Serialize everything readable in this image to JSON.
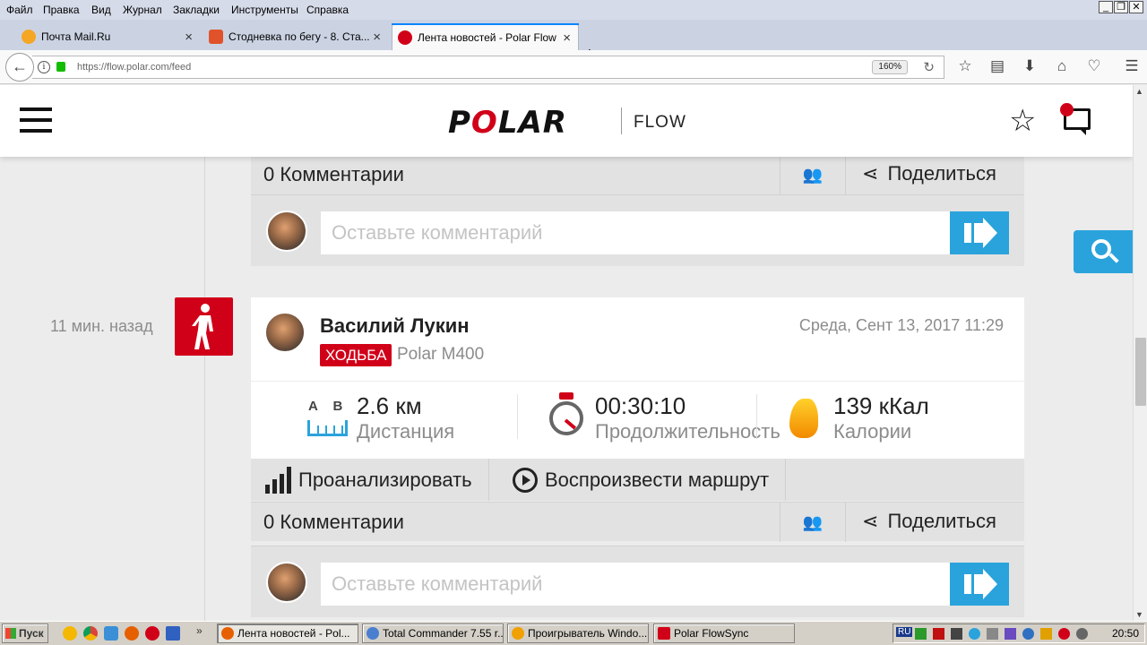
{
  "menubar": {
    "items": [
      "Файл",
      "Правка",
      "Вид",
      "Журнал",
      "Закладки",
      "Инструменты",
      "Справка"
    ]
  },
  "tabs": [
    {
      "label": "Почта Mail.Ru",
      "active": false
    },
    {
      "label": "Стодневка по бегу - 8. Ста...",
      "active": false
    },
    {
      "label": "Лента новостей - Polar Flow",
      "active": true
    }
  ],
  "navbar": {
    "url": "https://flow.polar.com/feed",
    "zoom": "160%"
  },
  "header": {
    "logo_text": "POLAR",
    "product": "FLOW"
  },
  "feed": {
    "prev_post": {
      "comments_count": "0 Комментарии",
      "share_label": "Поделиться",
      "comment_placeholder": "Оставьте комментарий"
    },
    "post": {
      "time_ago": "11 мин. назад",
      "user_name": "Василий Лукин",
      "date": "Среда, Сент 13, 2017 11:29",
      "sport": "ХОДЬБА",
      "device": "Polar M400",
      "metrics": {
        "distance_value": "2.6 км",
        "distance_label": "Дистанция",
        "ab_label": "A    B",
        "duration_value": "00:30:10",
        "duration_label": "Продолжительность",
        "calories_value": "139 кКал",
        "calories_label": "Калории"
      },
      "actions": {
        "analyze": "Проанализировать",
        "replay": "Воспроизвести маршрут"
      },
      "comments_count": "0 Комментарии",
      "share_label": "Поделиться",
      "comment_placeholder": "Оставьте комментарий"
    }
  },
  "taskbar": {
    "start": "Пуск",
    "windows": [
      "Лента новостей - Pol...",
      "Total Commander 7.55 r...",
      "Проигрыватель Windo...",
      "Polar FlowSync"
    ],
    "lang": "RU",
    "clock": "20:50"
  },
  "colors": {
    "polar_red": "#d10019",
    "accent_blue": "#2aa3dc"
  }
}
